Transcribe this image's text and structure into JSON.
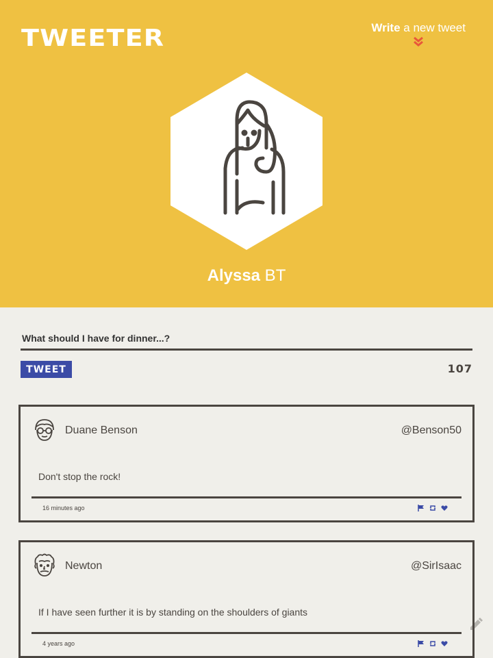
{
  "header": {
    "logo": "TWEETER",
    "write_strong": "Write",
    "write_rest": " a new tweet",
    "chevron_icon": "double-chevron-down-icon"
  },
  "profile": {
    "first_name": "Alyssa",
    "last_name": " BT",
    "avatar_icon": "woman-avatar-icon"
  },
  "compose": {
    "placeholder": "What should I have for dinner...?",
    "button_label": "TWEET",
    "char_count": "107"
  },
  "tweets": [
    {
      "name": "Duane Benson",
      "handle": "@Benson50",
      "text": "Don't stop the rock!",
      "time": "16 minutes ago",
      "avatar_icon": "man-with-glasses-avatar-icon"
    },
    {
      "name": "Newton",
      "handle": "@SirIsaac",
      "text": "If I have seen further it is by standing on the shoulders of giants",
      "time": "4 years ago",
      "avatar_icon": "man-curly-hair-avatar-icon"
    }
  ],
  "colors": {
    "header_bg": "#efc142",
    "page_bg": "#f0efea",
    "accent": "#3b4ba6",
    "chevron": "#e8573a",
    "text_dark": "#4a4540"
  }
}
